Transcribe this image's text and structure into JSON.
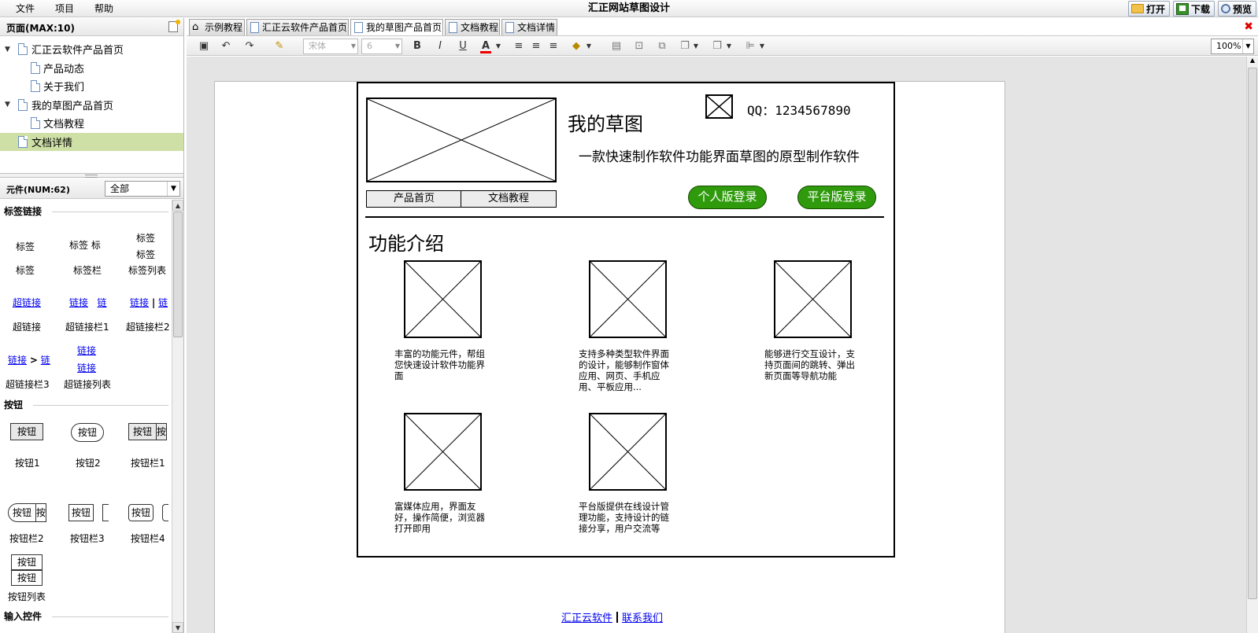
{
  "app": {
    "title": "汇正网站草图设计",
    "menu": [
      "文件",
      "项目",
      "帮助"
    ],
    "actions": {
      "open": "打开",
      "download": "下载",
      "preview": "预览"
    }
  },
  "pages_panel": {
    "header": "页面(MAX:10)",
    "tree": [
      {
        "label": "汇正云软件产品首页",
        "level": 0,
        "expanded": true
      },
      {
        "label": "产品动态",
        "level": 1
      },
      {
        "label": "关于我们",
        "level": 1
      },
      {
        "label": "我的草图产品首页",
        "level": 0,
        "expanded": true
      },
      {
        "label": "文档教程",
        "level": 1
      },
      {
        "label": "文档详情",
        "level": 0,
        "selected": true
      }
    ]
  },
  "components_panel": {
    "header": "元件(NUM:62)",
    "filter": "全部",
    "sections": {
      "label_links": "标签链接",
      "buttons": "按钮",
      "inputs": "输入控件"
    },
    "items": {
      "label": "标签",
      "label_bar": "标签栏",
      "label_bar_preview": "标签   标",
      "label_list": "标签列表",
      "link": "超链接",
      "link_bar1": "超链接栏1",
      "link_bar2": "超链接栏2",
      "link_bar3": "超链接栏3",
      "link_list": "超链接列表",
      "link_short": "链接",
      "link_cut": "链",
      "link_arrow": ">",
      "button": "按钮",
      "button_cut": "按",
      "button1": "按钮1",
      "button2": "按钮2",
      "button_bar1": "按钮栏1",
      "button_bar2": "按钮栏2",
      "button_bar3": "按钮栏3",
      "button_bar4": "按钮栏4",
      "button_list": "按钮列表"
    }
  },
  "tabs": [
    {
      "label": "示例教程",
      "icon": "home-icon"
    },
    {
      "label": "汇正云软件产品首页",
      "icon": "page-icon"
    },
    {
      "label": "我的草图产品首页",
      "icon": "page-icon",
      "active": true
    },
    {
      "label": "文档教程",
      "icon": "page-icon"
    },
    {
      "label": "文档详情",
      "icon": "page-icon"
    }
  ],
  "toolbar": {
    "font_family": "宋体",
    "font_size": "6",
    "bold": "B",
    "italic": "I",
    "underline": "U",
    "font_color": "A",
    "zoom": "100%"
  },
  "design": {
    "title": "我的草图",
    "tagline": "一款快速制作软件功能界面草图的原型制作软件",
    "qq": "QQ：1234567890",
    "nav": [
      "产品首页",
      "文档教程"
    ],
    "login_personal": "个人版登录",
    "login_platform": "平台版登录",
    "section_title": "功能介绍",
    "features": [
      "丰富的功能元件，帮组您快速设计软件功能界面",
      "支持多种类型软件界面的设计，能够制作窗体应用、网页、手机应用、平板应用...",
      "能够进行交互设计，支持页面间的跳转、弹出新页面等导航功能",
      "富媒体应用，界面友好，操作简便，浏览器打开即用",
      "平台版提供在线设计管理功能，支持设计的链接分享，用户交流等"
    ],
    "footer_links": [
      "汇正云软件",
      "联系我们"
    ]
  },
  "colors": {
    "accent_green": "#2f9b0c",
    "selected_row": "#cfe0a7",
    "link_blue": "#0000ee",
    "close_red": "#dd0000"
  }
}
